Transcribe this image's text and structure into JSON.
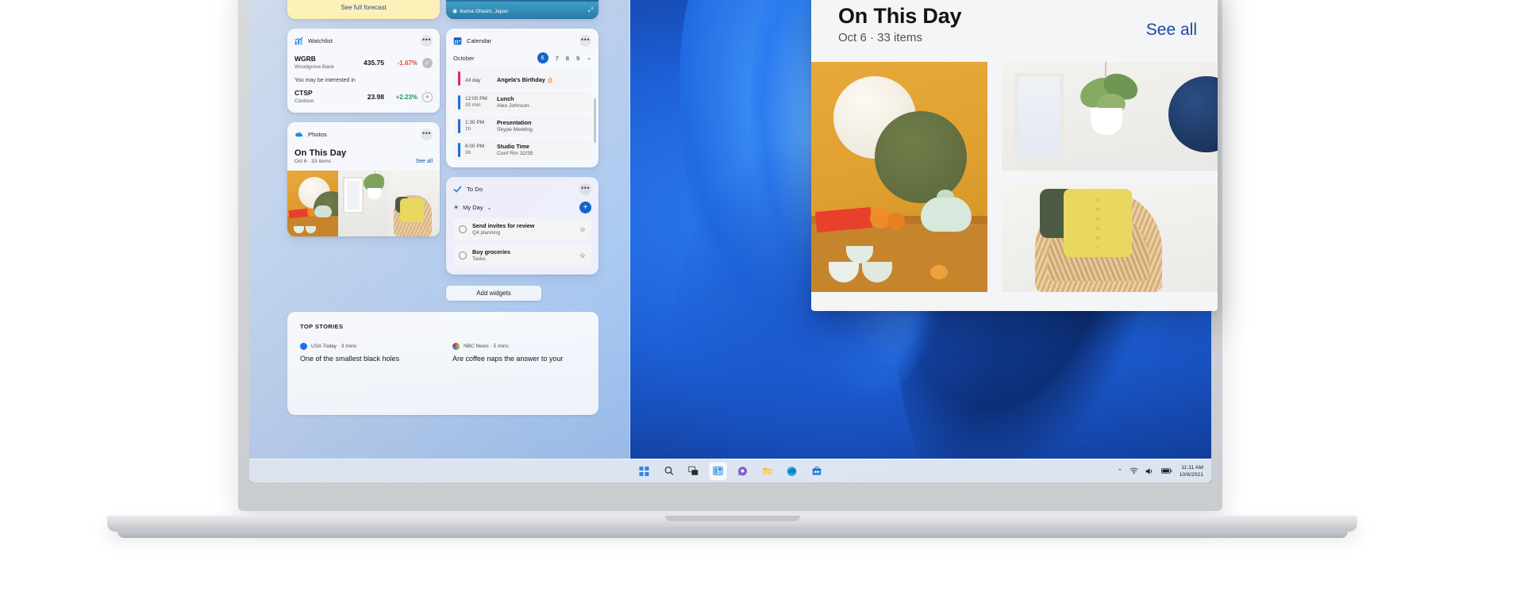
{
  "widgets": {
    "weather": {
      "see_full_forecast": "See full forecast"
    },
    "watchlist": {
      "title": "Watchlist",
      "more_label": "•••",
      "interested_label": "You may be interested in",
      "rows": [
        {
          "symbol": "WGRB",
          "company": "Woodgrove Bank",
          "price": "435.75",
          "change": "-1.67%",
          "direction": "down",
          "action": "✓"
        },
        {
          "symbol": "CTSP",
          "company": "Contoso",
          "price": "23.98",
          "change": "+2.23%",
          "direction": "up",
          "action": "+"
        }
      ]
    },
    "photos": {
      "title": "Photos",
      "more_label": "•••",
      "headline": "On This Day",
      "meta": "Oct 6   ·  33 items",
      "see_all": "See all"
    },
    "calendar": {
      "title": "Calendar",
      "more_label": "•••",
      "month": "October",
      "days": [
        "6",
        "7",
        "8",
        "9"
      ],
      "today": "6",
      "chevron": "⌄",
      "events": [
        {
          "time": "All day",
          "duration": "",
          "title": "Angela's Birthday 🎂",
          "subtitle": "",
          "color": "#e01f7a"
        },
        {
          "time": "12:00 PM",
          "duration": "30 min",
          "title": "Lunch",
          "subtitle": "Alex Johnson",
          "color": "#1b6fd4"
        },
        {
          "time": "1:30 PM",
          "duration": "1h",
          "title": "Presentation",
          "subtitle": "Skype Meeting",
          "color": "#1b6fd4"
        },
        {
          "time": "6:00 PM",
          "duration": "3h",
          "title": "Studio Time",
          "subtitle": "Conf Rm 32/35",
          "color": "#1b6fd4"
        }
      ]
    },
    "todo": {
      "title": "To Do",
      "more_label": "•••",
      "list_name": "My Day",
      "list_chevron": "⌄",
      "add_label": "+",
      "tasks": [
        {
          "title": "Send invites for review",
          "subtitle": "Q4 planning",
          "star": "☆"
        },
        {
          "title": "Buy groceries",
          "subtitle": "Tasks",
          "star": "☆"
        }
      ]
    },
    "add_widgets_label": "Add widgets",
    "top_stories": {
      "label": "TOP STORIES",
      "items": [
        {
          "source": "USA Today · 3 mins",
          "source_color": "#1a73e8",
          "headline": "One of the smallest black holes"
        },
        {
          "source": "NBC News · 5 mins",
          "source_color": "#d94a2b",
          "headline": "Are coffee naps the answer to your"
        }
      ]
    },
    "location_chip": "Ikema Ohashi, Japan"
  },
  "taskbar": {
    "icons": [
      {
        "name": "start-icon",
        "label": "Start"
      },
      {
        "name": "search-icon",
        "label": "Search"
      },
      {
        "name": "task-view-icon",
        "label": "Task view"
      },
      {
        "name": "widgets-icon",
        "label": "Widgets"
      },
      {
        "name": "chat-icon",
        "label": "Chat"
      },
      {
        "name": "file-explorer-icon",
        "label": "File Explorer"
      },
      {
        "name": "edge-icon",
        "label": "Microsoft Edge"
      },
      {
        "name": "store-icon",
        "label": "Microsoft Store"
      }
    ],
    "system": {
      "chevron": "⌃",
      "wifi": "wifi-icon",
      "volume": "volume-icon",
      "battery": "battery-icon"
    },
    "clock": {
      "time": "11:11 AM",
      "date": "10/6/2021"
    }
  },
  "on_this_day_panel": {
    "title": "On This Day",
    "subtitle": "Oct 6   ·  33 items",
    "see_all": "See all"
  },
  "colors": {
    "accent": "#1763c8",
    "link": "#1b4b9c",
    "up": "#0f9d58",
    "down": "#e34a3a",
    "birthday_bar": "#e01f7a",
    "event_bar": "#1b6fd4"
  }
}
